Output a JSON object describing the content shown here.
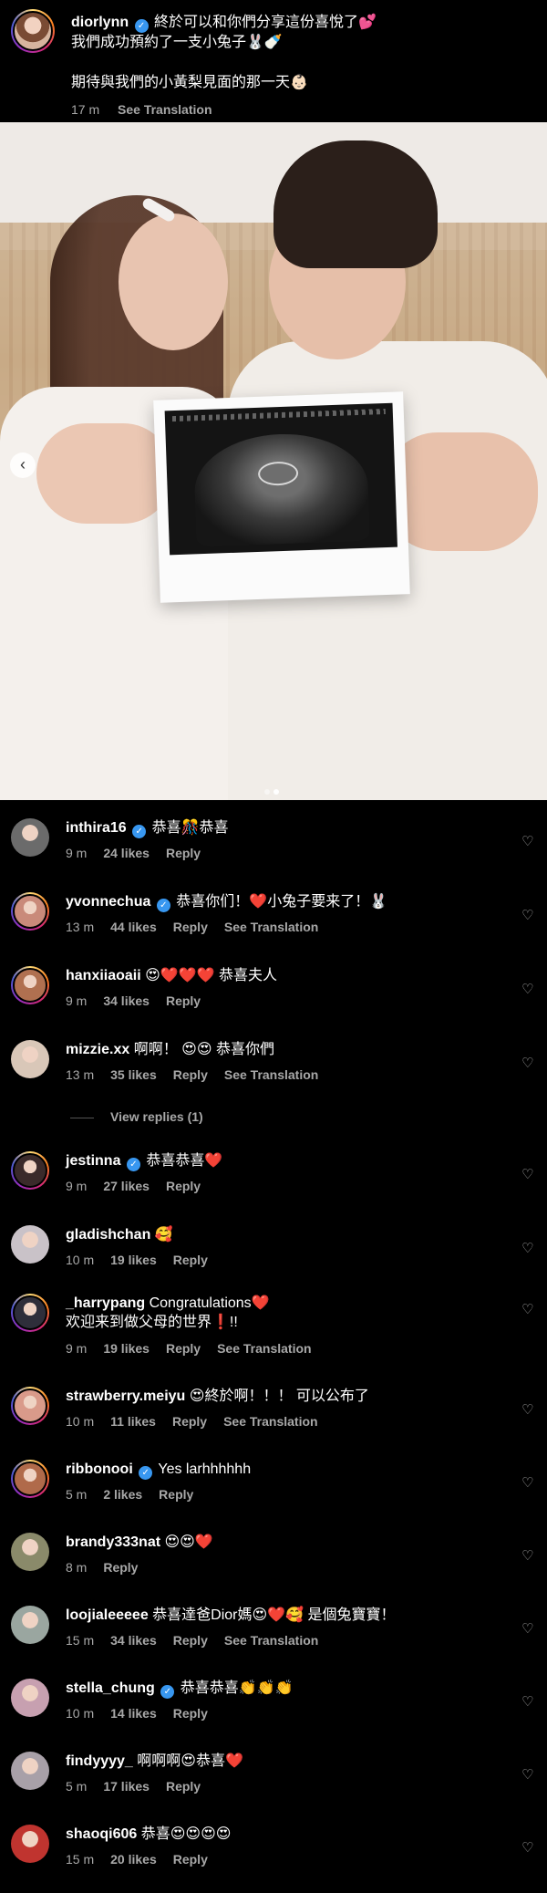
{
  "caption": {
    "username": "diorlynn",
    "line1": "終於可以和你們分享這份喜悅了💕",
    "line2": "我們成功預約了一支小兔子🐰🍼",
    "line3": "期待與我們的小黃梨見面的那一天👶🏻",
    "time": "17 m",
    "see_translation": "See Translation"
  },
  "photo": {
    "description_alt": "",
    "carousel_dots": 2,
    "active_dot": 2
  },
  "labels": {
    "reply": "Reply",
    "see_translation": "See Translation",
    "view_replies": "View replies (1)"
  },
  "comments": [
    {
      "username": "inthira16",
      "verified": true,
      "text": "恭喜🎊恭喜",
      "time": "9 m",
      "likes": "24 likes",
      "translate": false,
      "story": false,
      "avatar_color": "#6b6b6b"
    },
    {
      "username": "yvonnechua",
      "verified": true,
      "text": "恭喜你们！❤️小兔子要来了！🐰",
      "time": "13 m",
      "likes": "44 likes",
      "translate": true,
      "story": true,
      "avatar_color": "#c98a7a"
    },
    {
      "username": "hanxiiaoaii",
      "verified": false,
      "text": "😍❤️❤️❤️ 恭喜夫人",
      "time": "9 m",
      "likes": "34 likes",
      "translate": false,
      "story": true,
      "avatar_color": "#b07050"
    },
    {
      "username": "mizzie.xx",
      "verified": false,
      "text": "啊啊！ 😍😍 恭喜你們",
      "time": "13 m",
      "likes": "35 likes",
      "translate": true,
      "story": false,
      "avatar_color": "#d9c7b8"
    },
    {
      "username": "jestinna",
      "verified": true,
      "text": "恭喜恭喜❤️",
      "time": "9 m",
      "likes": "27 likes",
      "translate": false,
      "story": true,
      "avatar_color": "#3a2a2a"
    },
    {
      "username": "gladishchan",
      "verified": false,
      "text": "🥰",
      "time": "10 m",
      "likes": "19 likes",
      "translate": false,
      "story": false,
      "avatar_color": "#c9c2c8"
    },
    {
      "username": "_harrypang",
      "verified": false,
      "text": "Congratulations❤️",
      "text2": "欢迎来到做父母的世界❗️!!",
      "time": "9 m",
      "likes": "19 likes",
      "translate": true,
      "story": true,
      "avatar_color": "#2e2e3a"
    },
    {
      "username": "strawberry.meiyu",
      "verified": false,
      "text": "😍終於啊！！！ 可以公布了",
      "time": "10 m",
      "likes": "11 likes",
      "translate": true,
      "story": true,
      "avatar_color": "#d99a8a"
    },
    {
      "username": "ribbonooi",
      "verified": true,
      "text": "Yes larhhhhhh",
      "time": "5 m",
      "likes": "2 likes",
      "translate": false,
      "story": true,
      "avatar_color": "#b06a4a"
    },
    {
      "username": "brandy333nat",
      "verified": false,
      "text": "😍😍❤️",
      "time": "8 m",
      "likes": "",
      "translate": false,
      "story": false,
      "avatar_color": "#8a8a6a"
    },
    {
      "username": "loojialeeeee",
      "verified": false,
      "text": "恭喜達爸Dior媽😍❤️🥰 是個兔寶寶！",
      "time": "15 m",
      "likes": "34 likes",
      "translate": true,
      "story": false,
      "avatar_color": "#9aa6a0"
    },
    {
      "username": "stella_chung",
      "verified": true,
      "text": "恭喜恭喜👏👏👏",
      "time": "10 m",
      "likes": "14 likes",
      "translate": false,
      "story": false,
      "avatar_color": "#c7a0b0"
    },
    {
      "username": "findyyyy_",
      "verified": false,
      "text": "啊啊啊😍恭喜❤️",
      "time": "5 m",
      "likes": "17 likes",
      "translate": false,
      "story": false,
      "avatar_color": "#a8a0a8"
    },
    {
      "username": "shaoqi606",
      "verified": false,
      "text": "恭喜😍😍😍😍",
      "time": "15 m",
      "likes": "20 likes",
      "translate": false,
      "story": false,
      "avatar_color": "#c0342f"
    }
  ]
}
